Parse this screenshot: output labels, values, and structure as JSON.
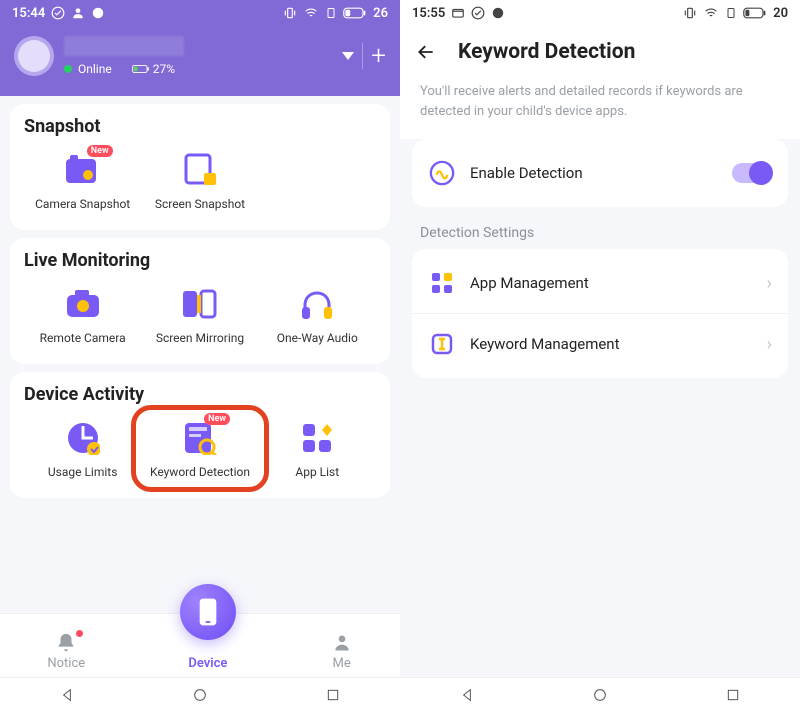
{
  "left": {
    "status": {
      "time": "15:44",
      "battery": "26"
    },
    "header": {
      "online": "Online",
      "battery": "27%"
    },
    "sections": {
      "snapshot": {
        "title": "Snapshot",
        "cameraSnapshot": "Camera Snapshot",
        "screenSnapshot": "Screen Snapshot",
        "newBadge": "New"
      },
      "live": {
        "title": "Live Monitoring",
        "remoteCamera": "Remote Camera",
        "screenMirroring": "Screen Mirroring",
        "oneWayAudio": "One-Way Audio"
      },
      "activity": {
        "title": "Device Activity",
        "usageLimits": "Usage Limits",
        "keywordDetection": "Keyword Detection",
        "appList": "App List",
        "newBadge": "New"
      }
    },
    "nav": {
      "notice": "Notice",
      "device": "Device",
      "me": "Me"
    }
  },
  "right": {
    "status": {
      "time": "15:55",
      "battery": "20"
    },
    "title": "Keyword Detection",
    "description": "You'll receive alerts and detailed records if keywords are detected in your child's device apps.",
    "enable": "Enable Detection",
    "settingsLabel": "Detection Settings",
    "appManagement": "App Management",
    "keywordManagement": "Keyword Management"
  }
}
